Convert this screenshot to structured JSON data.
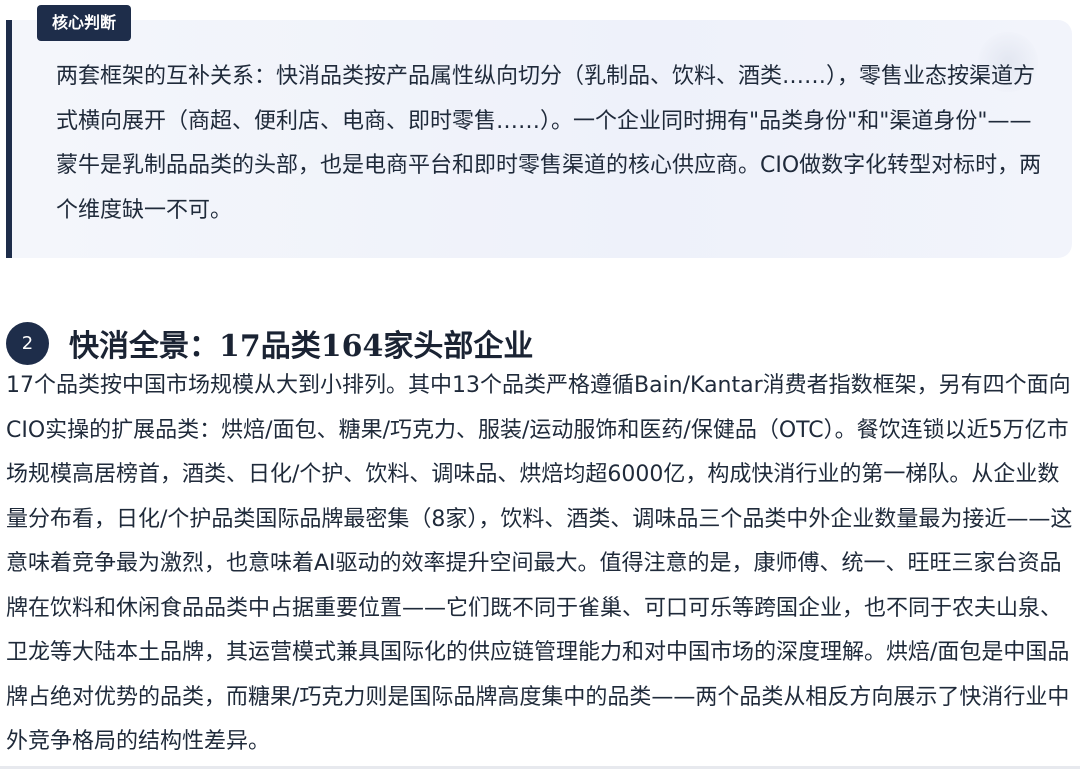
{
  "callout": {
    "badge": "核心判断",
    "text": "两套框架的互补关系：快消品类按产品属性纵向切分（乳制品、饮料、酒类……），零售业态按渠道方式横向展开（商超、便利店、电商、即时零售……）。一个企业同时拥有\"品类身份\"和\"渠道身份\"——蒙牛是乳制品品类的头部，也是电商平台和即时零售渠道的核心供应商。CIO做数字化转型对标时，两个维度缺一不可。"
  },
  "section": {
    "number": "2",
    "title": "快消全景：17品类164家头部企业"
  },
  "body": {
    "text": "17个品类按中国市场规模从大到小排列。其中13个品类严格遵循Bain/Kantar消费者指数框架，另有四个面向CIO实操的扩展品类：烘焙/面包、糖果/巧克力、服装/运动服饰和医药/保健品（OTC）。餐饮连锁以近5万亿市场规模高居榜首，酒类、日化/个护、饮料、调味品、烘焙均超6000亿，构成快消行业的第一梯队。从企业数量分布看，日化/个护品类国际品牌最密集（8家），饮料、酒类、调味品三个品类中外企业数量最为接近——这意味着竞争最为激烈，也意味着AI驱动的效率提升空间最大。值得注意的是，康师傅、统一、旺旺三家台资品牌在饮料和休闲食品品类中占据重要位置——它们既不同于雀巢、可口可乐等跨国企业，也不同于农夫山泉、卫龙等大陆本土品牌，其运营模式兼具国际化的供应链管理能力和对中国市场的深度理解。烘焙/面包是中国品牌占绝对优势的品类，而糖果/巧克力则是国际品牌高度集中的品类——两个品类从相反方向展示了快消行业中外竞争格局的结构性差异。"
  }
}
